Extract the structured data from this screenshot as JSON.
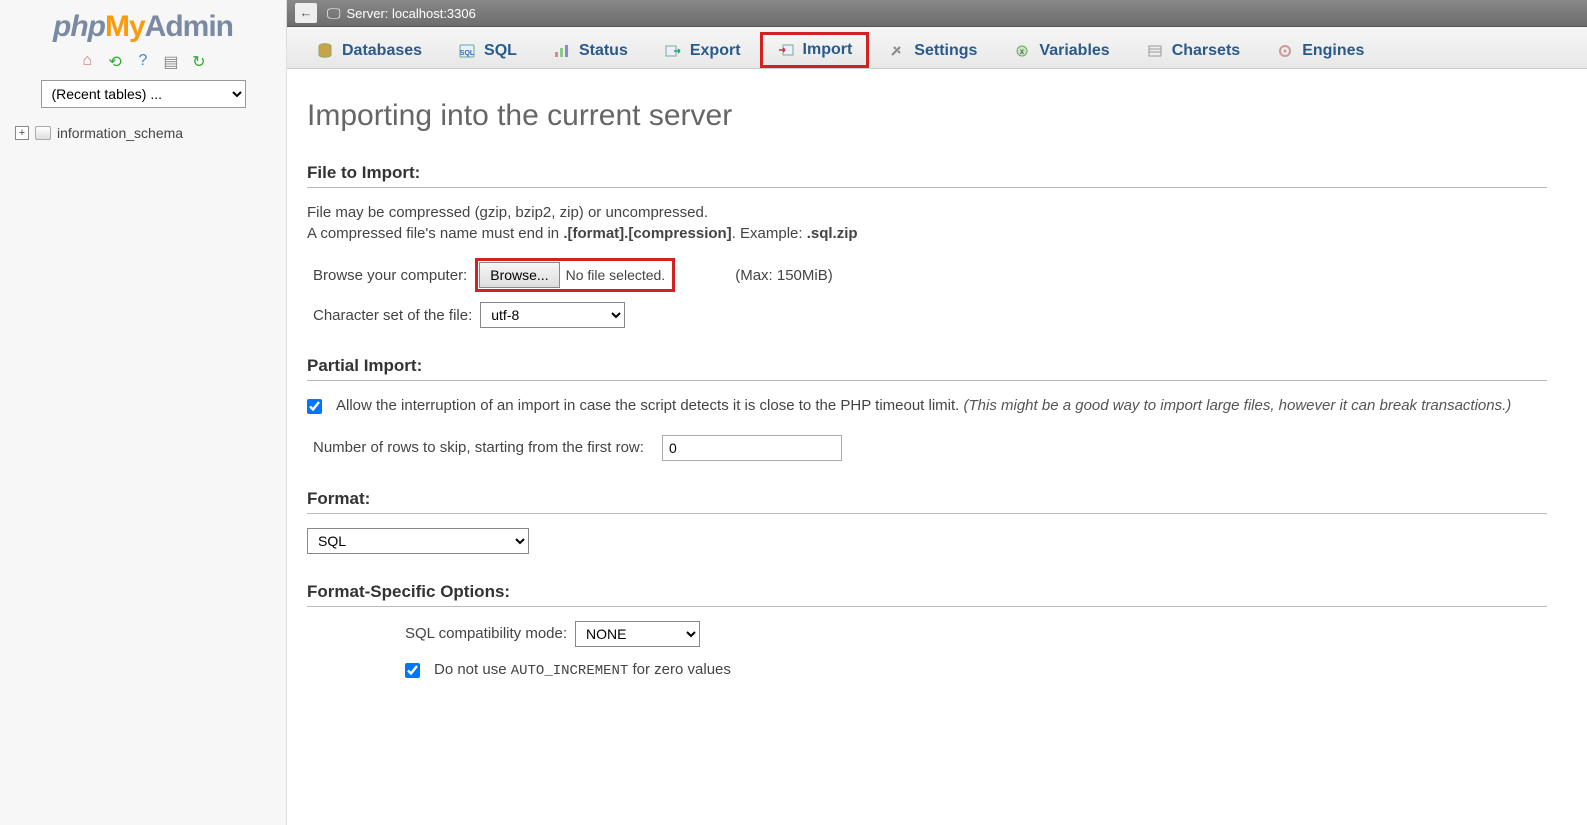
{
  "sidebar": {
    "logo_php": "php",
    "logo_my": "My",
    "logo_admin": "Admin",
    "recent_placeholder": "(Recent tables) ...",
    "db_item": "information_schema"
  },
  "topbar": {
    "back_glyph": "←",
    "server_label": "Server: localhost:3306"
  },
  "tabs": [
    {
      "label": "Databases",
      "name": "databases"
    },
    {
      "label": "SQL",
      "name": "sql"
    },
    {
      "label": "Status",
      "name": "status"
    },
    {
      "label": "Export",
      "name": "export"
    },
    {
      "label": "Import",
      "name": "import",
      "active": true,
      "highlight": true
    },
    {
      "label": "Settings",
      "name": "settings"
    },
    {
      "label": "Variables",
      "name": "variables"
    },
    {
      "label": "Charsets",
      "name": "charsets"
    },
    {
      "label": "Engines",
      "name": "engines"
    }
  ],
  "page": {
    "title": "Importing into the current server",
    "file_section": "File to Import:",
    "file_note_1": "File may be compressed (gzip, bzip2, zip) or uncompressed.",
    "file_note_2a": "A compressed file's name must end in ",
    "file_note_2b": ".[format].[compression]",
    "file_note_2c": ". Example: ",
    "file_note_2d": ".sql.zip",
    "browse_label": "Browse your computer:",
    "browse_btn": "Browse...",
    "file_selected": "No file selected.",
    "max_hint": "(Max: 150MiB)",
    "charset_label": "Character set of the file:",
    "charset_value": "utf-8",
    "partial_section": "Partial Import:",
    "allow_interrupt": "Allow the interruption of an import in case the script detects it is close to the PHP timeout limit. ",
    "allow_interrupt_italic": "(This might be a good way to import large files, however it can break transactions.)",
    "skip_label": "Number of rows to skip, starting from the first row:",
    "skip_value": "0",
    "format_section": "Format:",
    "format_value": "SQL",
    "fso_section": "Format-Specific Options:",
    "sql_compat_label": "SQL compatibility mode:",
    "sql_compat_value": "NONE",
    "auto_inc_a": "Do not use ",
    "auto_inc_b": "AUTO_INCREMENT",
    "auto_inc_c": " for zero values"
  }
}
